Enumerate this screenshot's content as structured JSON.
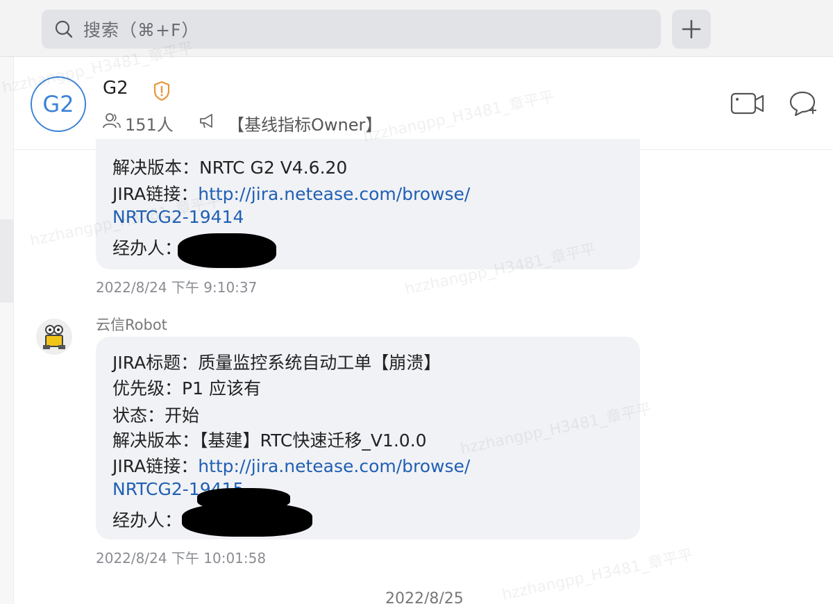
{
  "search": {
    "placeholder": "搜索（⌘+F）"
  },
  "toolbar": {
    "add_label": "+"
  },
  "group": {
    "avatar_text": "G2",
    "name": "G2",
    "member_count": "151人",
    "announcement": "【基线指标Owner】"
  },
  "messages": [
    {
      "lines": [
        {
          "label": "解决版本：",
          "value": "NRTC G2 V4.6.20"
        },
        {
          "label": "JIRA链接：",
          "link": "http://jira.netease.com/browse/"
        },
        {
          "link_cont": "NRTCG2-19414"
        },
        {
          "label": "经办人："
        }
      ],
      "timestamp": "2022/8/24 下午 9:10:37"
    },
    {
      "sender": "云信Robot",
      "lines": [
        {
          "label": "JIRA标题：",
          "value": "质量监控系统自动工单【崩溃】"
        },
        {
          "label": "优先级：",
          "value": "P1 应该有"
        },
        {
          "label": "状态：",
          "value": "开始"
        },
        {
          "label": "解决版本：",
          "value": "【基建】RTC快速迁移_V1.0.0"
        },
        {
          "label": "JIRA链接：",
          "link": "http://jira.netease.com/browse/"
        },
        {
          "link_cont": "NRTCG2-19415"
        },
        {
          "label": "经办人："
        }
      ],
      "timestamp": "2022/8/24 下午 10:01:58"
    }
  ],
  "date_divider": "2022/8/25",
  "watermark": "hzzhangpp_H3481_章平平",
  "colors": {
    "accent": "#3b82d6",
    "link": "#1f5fb4",
    "bubble": "#f1f2f5",
    "warning": "#e8953a"
  }
}
